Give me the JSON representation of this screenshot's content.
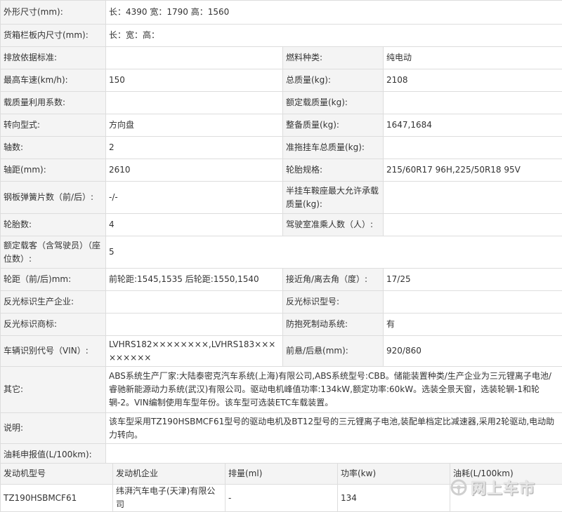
{
  "spec": {
    "dimensions": {
      "label": "外形尺寸(mm):",
      "value": "长：4390 宽：1790 高：1560"
    },
    "cargo": {
      "label": "货箱栏板内尺寸(mm):",
      "value": "长：宽：高："
    },
    "emission": {
      "label": "排放依据标准:",
      "value": ""
    },
    "fuel": {
      "label": "燃料种类:",
      "value": "纯电动"
    },
    "speed": {
      "label": "最高车速(km/h):",
      "value": "150"
    },
    "total_mass": {
      "label": "总质量(kg):",
      "value": "2108"
    },
    "load_util": {
      "label": "载质量利用系数:",
      "value": ""
    },
    "rated_load": {
      "label": "额定载质量(kg):",
      "value": ""
    },
    "steering": {
      "label": "转向型式:",
      "value": "方向盘"
    },
    "curb_mass": {
      "label": "整备质量(kg):",
      "value": "1647,1684"
    },
    "axles": {
      "label": "轴数:",
      "value": "2"
    },
    "trailer_mass": {
      "label": "准拖挂车总质量(kg):",
      "value": ""
    },
    "wheelbase": {
      "label": "轴距(mm):",
      "value": "2610"
    },
    "tires": {
      "label": "轮胎规格:",
      "value": "215/60R17 96H,225/50R18 95V"
    },
    "springs": {
      "label": "钢板弹簧片数（前/后）:",
      "value": "-/-"
    },
    "saddle_mass": {
      "label": "半挂车鞍座最大允许承载质量(kg):",
      "value": ""
    },
    "tire_count": {
      "label": "轮胎数:",
      "value": "4"
    },
    "cab_persons": {
      "label": "驾驶室准乘人数（人）:",
      "value": ""
    },
    "passengers": {
      "label": "额定载客（含驾驶员）（座位数）:",
      "value": "5"
    },
    "track": {
      "label": "轮距（前/后)mm:",
      "value": "前轮距:1545,1535 后轮距:1550,1540"
    },
    "angles": {
      "label": "接近角/离去角（度）:",
      "value": "17/25"
    },
    "reflect_maker": {
      "label": "反光标识生产企业:",
      "value": ""
    },
    "reflect_model": {
      "label": "反光标识型号:",
      "value": ""
    },
    "reflect_brand": {
      "label": "反光标识商标:",
      "value": ""
    },
    "abs": {
      "label": "防抱死制动系统:",
      "value": "有"
    },
    "vin": {
      "label": "车辆识别代号（VIN）:",
      "value": "LVHRS182××××××××,LVHRS183×××××××××"
    },
    "overhang": {
      "label": "前悬/后悬(mm):",
      "value": "920/860"
    },
    "other": {
      "label": "其它:",
      "value": "ABS系统生产厂家:大陆泰密克汽车系统(上海)有限公司,ABS系统型号:CBB。储能装置种类/生产企业为三元锂离子电池/睿驰新能源动力系统(武汉)有限公司。驱动电机峰值功率:134kW,额定功率:60kW。选装全景天窗，选装轮辋-1和轮辋-2。VIN编制使用车型年份。该车型可选装ETC车载装置。"
    },
    "note": {
      "label": "说明:",
      "value": "该车型采用TZ190HSBMCF61型号的驱动电机及BT12型号的三元锂离子电池,装配单档定比减速器,采用2轮驱动,电动助力转向。"
    },
    "fuel_consumption": {
      "label": "油耗申报值(L/100km):",
      "value": ""
    }
  },
  "engine": {
    "headers": [
      "发动机型号",
      "发动机企业",
      "排量(ml)",
      "功率(kw)",
      "油耗(L/100km)"
    ],
    "row": [
      "TZ190HSBMCF61",
      "纬湃汽车电子(天津)有限公司",
      "-",
      "134",
      ""
    ]
  },
  "watermark": {
    "text": "网上车市"
  }
}
